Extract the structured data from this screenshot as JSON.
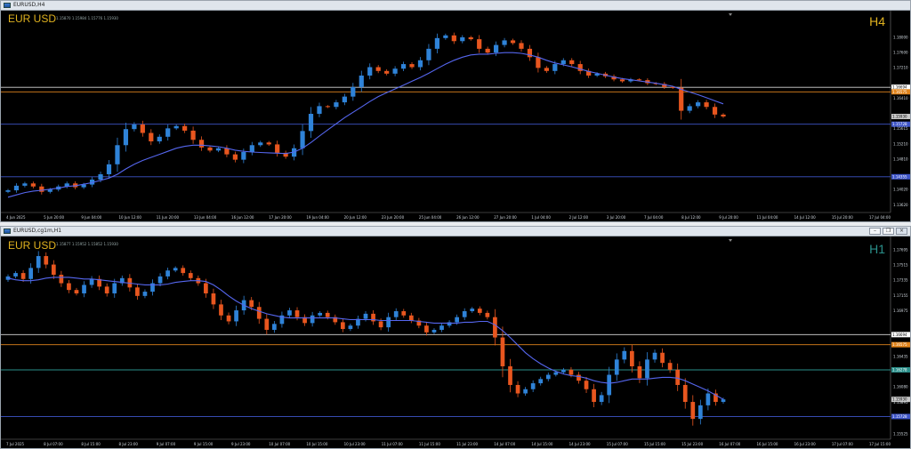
{
  "colors": {
    "bull": "#2f83d8",
    "bear": "#e8561f",
    "ma": "#5566ee",
    "white_line": "#d8d8d8",
    "orange_line": "#e0841c",
    "blue_line": "#3e55c8",
    "teal_line": "#2a8f8a"
  },
  "top": {
    "title": "EURUSD,H4",
    "symbol_label": "EUR USD",
    "timeframe": "H4",
    "tf_color": "#e0b21f",
    "ohlc_info": "1.15870 1.15984 1.15776 1.15930",
    "price_axis": [
      "1.18000",
      "1.17600",
      "1.17210",
      "1.16410",
      "1.15615",
      "1.15210",
      "1.14810",
      "1.14020",
      "1.13620"
    ],
    "price_range": [
      1.1342,
      1.1865
    ],
    "levels": [
      {
        "price": 1.16694,
        "label": "1.16694",
        "style": "white"
      },
      {
        "price": 1.16575,
        "label": "1.16575",
        "style": "orange"
      },
      {
        "price": 1.1593,
        "label": "1.15930",
        "style": "price"
      },
      {
        "price": 1.15728,
        "label": "1.15728",
        "style": "blue"
      },
      {
        "price": 1.14355,
        "label": "1.14355",
        "style": "blue"
      }
    ],
    "time_axis": [
      "4 Jun 2025",
      "5 Jun 20:00",
      "9 Jun 04:00",
      "10 Jun 12:00",
      "11 Jun 20:00",
      "13 Jun 04:00",
      "16 Jun 12:00",
      "17 Jun 20:00",
      "19 Jun 04:00",
      "20 Jun 12:00",
      "23 Jun 20:00",
      "25 Jun 04:00",
      "26 Jun 12:00",
      "27 Jun 20:00",
      "1 Jul 04:00",
      "2 Jul 12:00",
      "3 Jul 20:00",
      "7 Jul 04:00",
      "8 Jul 12:00",
      "9 Jul 20:00",
      "11 Jul 04:00",
      "14 Jul 12:00",
      "15 Jul 20:00",
      "17 Jul 04:00"
    ]
  },
  "bottom": {
    "title": "EURUSD,cg1m,H1",
    "symbol_label": "EUR USD",
    "timeframe": "H1",
    "tf_color": "#2a8f8a",
    "ohlc_info": "1.15877 1.15952 1.15852 1.15930",
    "price_axis": [
      "1.17695",
      "1.17515",
      "1.17335",
      "1.17155",
      "1.16975",
      "1.16435",
      "1.16080",
      "1.15895",
      "1.15525"
    ],
    "price_range": [
      1.1546,
      1.1783
    ],
    "levels": [
      {
        "price": 1.16694,
        "label": "1.16694",
        "style": "white"
      },
      {
        "price": 1.16575,
        "label": "1.16575",
        "style": "orange"
      },
      {
        "price": 1.16278,
        "label": "1.16278",
        "style": "teal"
      },
      {
        "price": 1.1593,
        "label": "1.15930",
        "style": "price"
      },
      {
        "price": 1.15728,
        "label": "1.15728",
        "style": "blue"
      }
    ],
    "time_axis": [
      "7 Jul 2025",
      "8 Jul 07:00",
      "8 Jul 15:00",
      "8 Jul 23:00",
      "9 Jul 07:00",
      "9 Jul 15:00",
      "9 Jul 23:00",
      "10 Jul 07:00",
      "10 Jul 15:00",
      "10 Jul 23:00",
      "11 Jul 07:00",
      "11 Jul 15:00",
      "11 Jul 23:00",
      "14 Jul 07:00",
      "14 Jul 15:00",
      "14 Jul 23:00",
      "15 Jul 07:00",
      "15 Jul 15:00",
      "15 Jul 23:00",
      "16 Jul 07:00",
      "16 Jul 15:00",
      "16 Jul 23:00",
      "17 Jul 07:00",
      "17 Jul 15:00"
    ]
  },
  "chart_data": [
    {
      "type": "candlestick",
      "title": "EURUSD,H4",
      "ylim": [
        1.1342,
        1.1865
      ],
      "close_path": [
        1.14,
        1.1412,
        1.1418,
        1.141,
        1.1396,
        1.1402,
        1.141,
        1.1418,
        1.1408,
        1.1415,
        1.1428,
        1.1442,
        1.1468,
        1.1518,
        1.156,
        1.1572,
        1.155,
        1.1528,
        1.154,
        1.1562,
        1.1568,
        1.1556,
        1.1532,
        1.1512,
        1.1504,
        1.151,
        1.1494,
        1.148,
        1.15,
        1.1518,
        1.1525,
        1.152,
        1.1498,
        1.1488,
        1.151,
        1.1555,
        1.16,
        1.162,
        1.1618,
        1.163,
        1.1645,
        1.167,
        1.17,
        1.1722,
        1.1712,
        1.1705,
        1.1718,
        1.173,
        1.1722,
        1.174,
        1.177,
        1.1798,
        1.1805,
        1.179,
        1.18,
        1.1795,
        1.177,
        1.176,
        1.178,
        1.1792,
        1.1785,
        1.177,
        1.1748,
        1.172,
        1.1712,
        1.173,
        1.174,
        1.173,
        1.1712,
        1.17,
        1.1705,
        1.1698,
        1.169,
        1.1685,
        1.169,
        1.1688,
        1.168,
        1.1678,
        1.167,
        1.1668,
        1.1608,
        1.162,
        1.163,
        1.1618,
        1.1598,
        1.1593
      ],
      "moving_average": [
        1.1382,
        1.1388,
        1.1394,
        1.1398,
        1.14,
        1.1403,
        1.1406,
        1.141,
        1.1412,
        1.1416,
        1.142,
        1.1426,
        1.1432,
        1.1442,
        1.1456,
        1.1468,
        1.1478,
        1.1486,
        1.1494,
        1.1502,
        1.151,
        1.1515,
        1.1518,
        1.1518,
        1.1516,
        1.1514,
        1.151,
        1.1505,
        1.1502,
        1.15,
        1.1499,
        1.1498,
        1.1497,
        1.1496,
        1.15,
        1.151,
        1.1525,
        1.1542,
        1.1558,
        1.1574,
        1.159,
        1.1604,
        1.1618,
        1.1632,
        1.1645,
        1.1655,
        1.1665,
        1.1675,
        1.1685,
        1.1695,
        1.1706,
        1.1718,
        1.173,
        1.174,
        1.1748,
        1.1754,
        1.1756,
        1.1756,
        1.1758,
        1.176,
        1.176,
        1.1758,
        1.1754,
        1.1748,
        1.174,
        1.1733,
        1.1728,
        1.1723,
        1.1717,
        1.1711,
        1.1706,
        1.1701,
        1.1696,
        1.1692,
        1.1689,
        1.1686,
        1.1683,
        1.168,
        1.1676,
        1.1672,
        1.1664,
        1.1657,
        1.165,
        1.1642,
        1.1634,
        1.1626
      ]
    },
    {
      "type": "candlestick",
      "title": "EURUSD,cg1m,H1",
      "ylim": [
        1.1546,
        1.1783
      ],
      "close_path": [
        1.1738,
        1.1742,
        1.1735,
        1.1748,
        1.1762,
        1.1752,
        1.174,
        1.173,
        1.1722,
        1.1718,
        1.1728,
        1.1735,
        1.1726,
        1.1718,
        1.173,
        1.1736,
        1.1725,
        1.1715,
        1.172,
        1.173,
        1.1738,
        1.1745,
        1.1748,
        1.1742,
        1.1736,
        1.173,
        1.1718,
        1.1705,
        1.1692,
        1.1685,
        1.1698,
        1.171,
        1.1702,
        1.1688,
        1.1675,
        1.1682,
        1.1692,
        1.1698,
        1.169,
        1.1683,
        1.1692,
        1.1695,
        1.169,
        1.1684,
        1.1676,
        1.168,
        1.1688,
        1.1694,
        1.1685,
        1.1678,
        1.169,
        1.1697,
        1.1692,
        1.1686,
        1.168,
        1.1672,
        1.1675,
        1.168,
        1.1684,
        1.169,
        1.1697,
        1.17,
        1.1695,
        1.169,
        1.1666,
        1.1632,
        1.161,
        1.16,
        1.1605,
        1.1612,
        1.1617,
        1.1622,
        1.1625,
        1.1628,
        1.1622,
        1.1615,
        1.1605,
        1.159,
        1.1598,
        1.1622,
        1.164,
        1.165,
        1.1632,
        1.1618,
        1.164,
        1.1648,
        1.1636,
        1.1628,
        1.161,
        1.159,
        1.157,
        1.1586,
        1.16,
        1.159,
        1.1593
      ],
      "moving_average": [
        1.1736,
        1.1734,
        1.1733,
        1.1733,
        1.1734,
        1.1736,
        1.1737,
        1.1737,
        1.1737,
        1.1736,
        1.1735,
        1.1735,
        1.1734,
        1.1733,
        1.1732,
        1.1731,
        1.173,
        1.1729,
        1.1728,
        1.1728,
        1.1728,
        1.1729,
        1.1731,
        1.1732,
        1.1733,
        1.1733,
        1.1732,
        1.1728,
        1.1722,
        1.1715,
        1.1709,
        1.1704,
        1.17,
        1.1697,
        1.1694,
        1.1692,
        1.169,
        1.1689,
        1.1689,
        1.1689,
        1.1689,
        1.1689,
        1.1689,
        1.1689,
        1.1688,
        1.1687,
        1.1687,
        1.1687,
        1.1687,
        1.1686,
        1.1686,
        1.1686,
        1.1686,
        1.1686,
        1.1685,
        1.1684,
        1.1683,
        1.1683,
        1.1683,
        1.1683,
        1.1684,
        1.1684,
        1.1685,
        1.1685,
        1.1681,
        1.1674,
        1.1666,
        1.1657,
        1.1648,
        1.1641,
        1.1635,
        1.163,
        1.1626,
        1.1623,
        1.1621,
        1.162,
        1.1618,
        1.1615,
        1.1613,
        1.1612,
        1.1613,
        1.1615,
        1.1617,
        1.1617,
        1.1617,
        1.1618,
        1.1619,
        1.1619,
        1.1618,
        1.1615,
        1.1611,
        1.1607,
        1.1603,
        1.1598,
        1.1593
      ]
    }
  ]
}
